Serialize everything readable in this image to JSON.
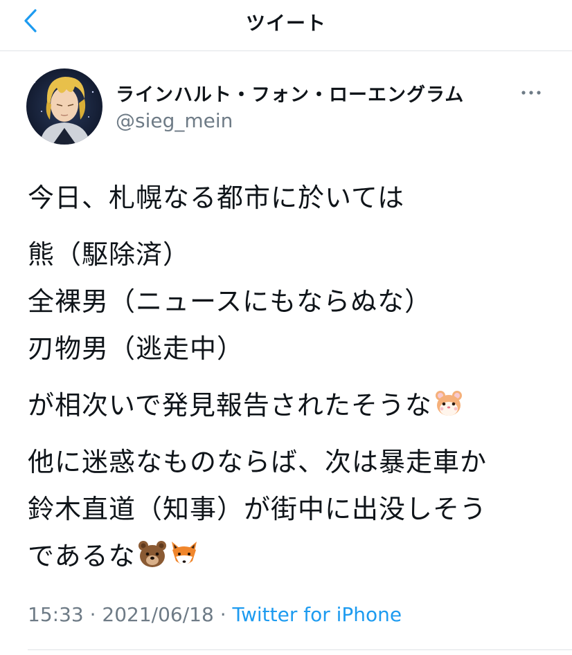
{
  "header": {
    "title": "ツイート",
    "back_icon": "chevron-left-icon"
  },
  "colors": {
    "accent": "#1d9bf0",
    "secondary_text": "#6e7b86",
    "primary_text": "#0f1419"
  },
  "tweet": {
    "display_name": "ラインハルト・フォン・ローエングラム",
    "handle": "@sieg_mein",
    "avatar": "avatar-portrait-blond-man",
    "more_icon": "more-horizontal-icon",
    "text": {
      "p1": [
        "今日、札幌なる都市に於いては"
      ],
      "p2": [
        "熊（駆除済）",
        "全裸男（ニュースにもならぬな）",
        "刃物男（逃走中）"
      ],
      "p3": [
        "が相次いで発見報告されたそうな"
      ],
      "p4": [
        "他に迷惑なものならば、次は暴走車か",
        "鈴木直道（知事）が街中に出没しそう",
        "であるな"
      ]
    },
    "emojis": {
      "p3_end": "hamster-face-emoji",
      "p4_end_1": "bear-face-emoji",
      "p4_end_2": "fox-face-emoji"
    },
    "time": "15:33",
    "separator": " · ",
    "date": "2021/06/18",
    "source": "Twitter for iPhone"
  }
}
